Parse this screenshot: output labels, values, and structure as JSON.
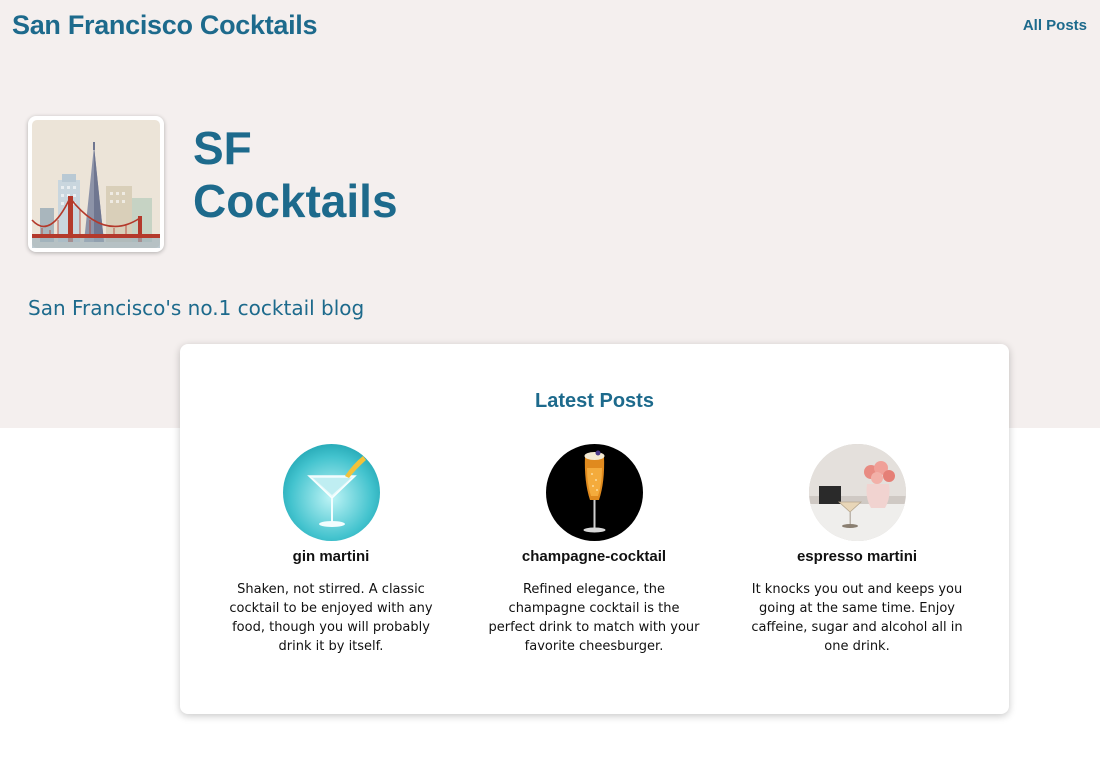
{
  "header": {
    "site_title": "San Francisco Cocktails",
    "nav": {
      "all_posts_label": "All Posts"
    }
  },
  "hero": {
    "brand_line1": "SF",
    "brand_line2": "Cocktails",
    "tagline": "San Francisco's no.1 cocktail blog",
    "logo_icon": "sf-skyline-icon"
  },
  "latest_posts": {
    "heading": "Latest Posts",
    "posts": [
      {
        "title": "gin martini",
        "description": "Shaken, not stirred. A classic cocktail to be enjoyed with any food, though you will probably drink it by itself.",
        "thumb_icon": "martini-glass-icon"
      },
      {
        "title": "champagne-cocktail",
        "description": "Refined elegance, the champagne cocktail is the perfect drink to match with your favorite cheesburger.",
        "thumb_icon": "champagne-flute-icon"
      },
      {
        "title": "espresso martini",
        "description": "It knocks you out and keeps you going at the same time. Enjoy caffeine, sugar and alcohol all in one drink.",
        "thumb_icon": "espresso-martini-photo-icon"
      }
    ]
  },
  "colors": {
    "brand": "#1d6a8c",
    "hero_bg": "#f4efee",
    "card_bg": "#ffffff",
    "text": "#111111"
  }
}
